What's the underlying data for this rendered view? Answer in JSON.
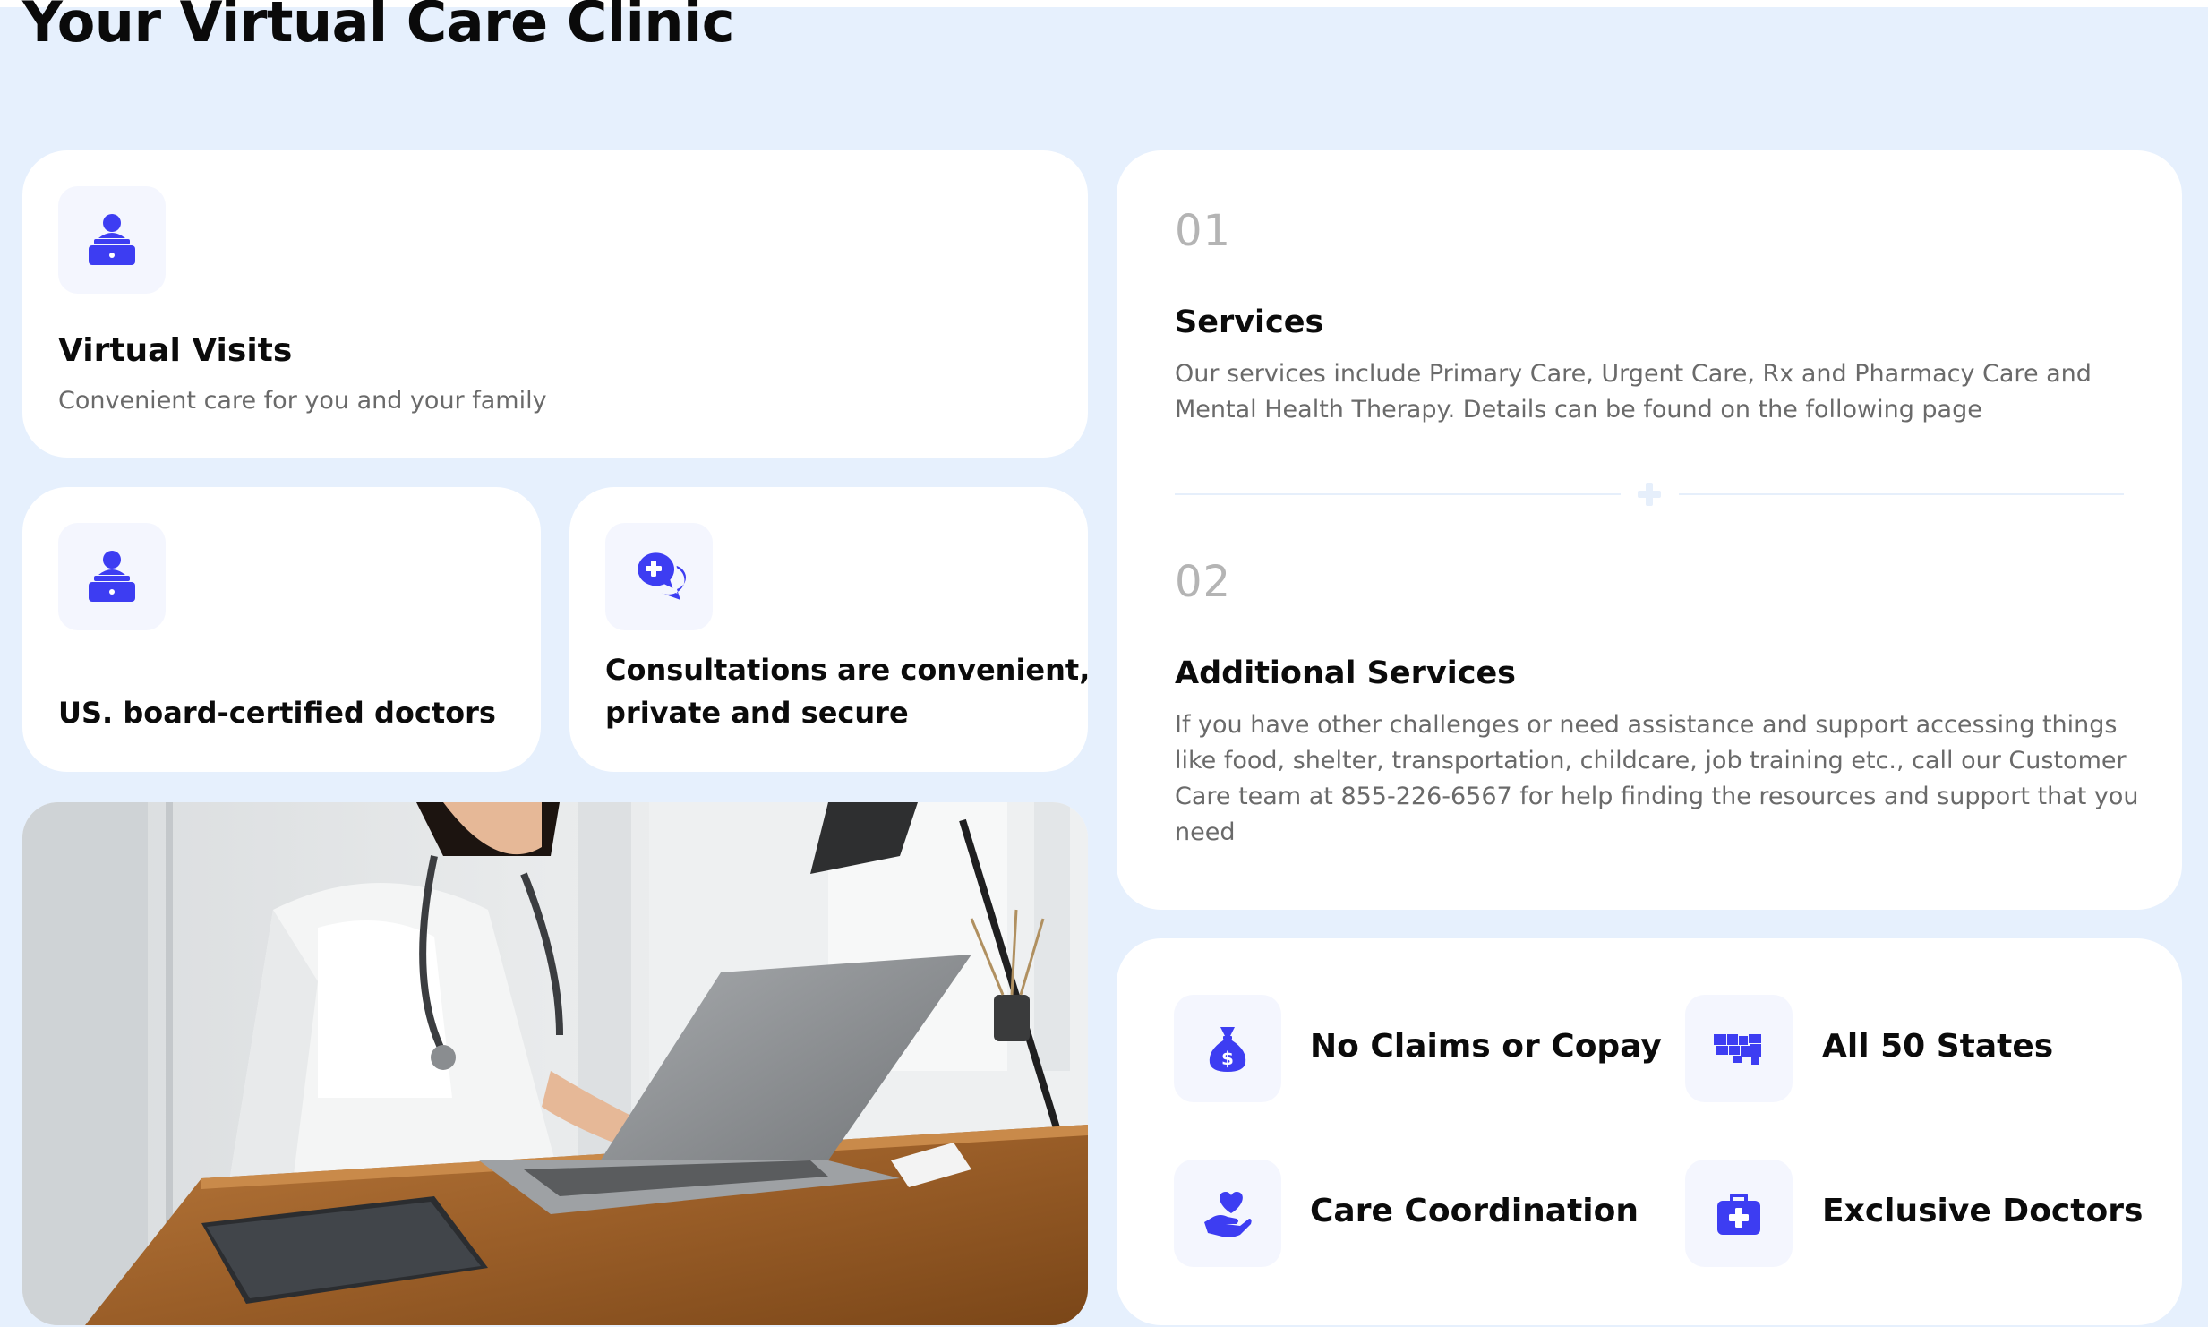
{
  "page": {
    "title": "Your Virtual Care Clinic"
  },
  "colors": {
    "accent": "#3d3df2",
    "background": "#e6f0fd",
    "card": "#ffffff"
  },
  "virtual_visits": {
    "icon": "doctor-laptop-icon",
    "title": "Virtual Visits",
    "description": "Convenient care for you and your family"
  },
  "doctors_card": {
    "icon": "doctor-laptop-icon",
    "title": "US. board-certified doctors"
  },
  "consult_card": {
    "icon": "medical-chat-icon",
    "title_line1": "Consultations are convenient,",
    "title_line2": "private and secure"
  },
  "photo": {
    "alt": "Doctor typing on a laptop at a wooden desk"
  },
  "services": [
    {
      "number": "01",
      "title": "Services",
      "line1": "Our services include Primary Care, Urgent Care, Rx and Pharmacy Care and",
      "line2": "Mental Health Therapy. Details can be found on the following page"
    },
    {
      "number": "02",
      "title": "Additional Services",
      "line1": "If you have other challenges or need assistance and support accessing things",
      "line2": "like food, shelter, transportation, childcare, job training etc., call our Customer",
      "line3": "Care team at 855-226-6567 for help finding the resources and support that you",
      "line4": "need"
    }
  ],
  "features": [
    {
      "icon": "money-bag-icon",
      "label": "No Claims or Copay"
    },
    {
      "icon": "us-map-icon",
      "label": "All 50 States"
    },
    {
      "icon": "heart-hand-icon",
      "label": "Care Coordination"
    },
    {
      "icon": "medical-kit-icon",
      "label": "Exclusive Doctors"
    }
  ]
}
